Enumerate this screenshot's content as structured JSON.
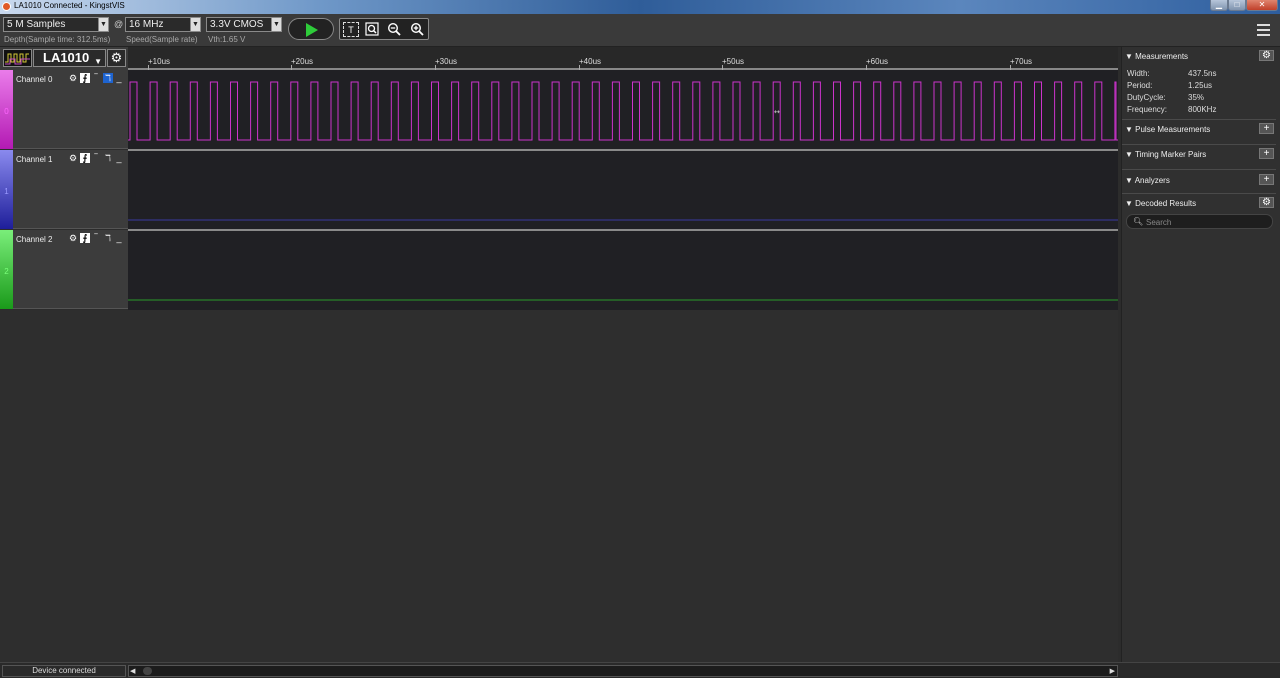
{
  "window": {
    "title": "LA1010 Connected - KingstVIS"
  },
  "toolbar": {
    "depth": "5 M Samples",
    "depth_sub": "Depth(Sample time: 312.5ms)",
    "at": "@",
    "speed": "16 MHz",
    "speed_sub": "Speed(Sample rate)",
    "voltage": "3.3V CMOS",
    "voltage_sub": "Vth:1.65 V",
    "colors": {
      "play": "#2ecc3a"
    }
  },
  "device": {
    "name": "LA1010"
  },
  "ruler": {
    "ticks": [
      "+10us",
      "+20us",
      "+30us",
      "+40us",
      "+50us",
      "+60us",
      "+70us"
    ]
  },
  "channels": [
    {
      "num": "0",
      "name": "Channel 0",
      "color": "#cc33cc"
    },
    {
      "num": "1",
      "name": "Channel 1",
      "color": "#3a3aa0"
    },
    {
      "num": "2",
      "name": "Channel 2",
      "color": "#2a9a2a"
    }
  ],
  "panel": {
    "measurements": {
      "title": "Measurements",
      "rows": [
        {
          "label": "Width:",
          "value": "437.5ns"
        },
        {
          "label": "Period:",
          "value": "1.25us"
        },
        {
          "label": "DutyCycle:",
          "value": "35%"
        },
        {
          "label": "Frequency:",
          "value": "800KHz"
        }
      ]
    },
    "pulse": "Pulse Measurements",
    "timing": "Timing Marker Pairs",
    "analyzers": "Analyzers",
    "decoded": "Decoded Results",
    "search_placeholder": "Search"
  },
  "status": {
    "text": "Device connected"
  }
}
